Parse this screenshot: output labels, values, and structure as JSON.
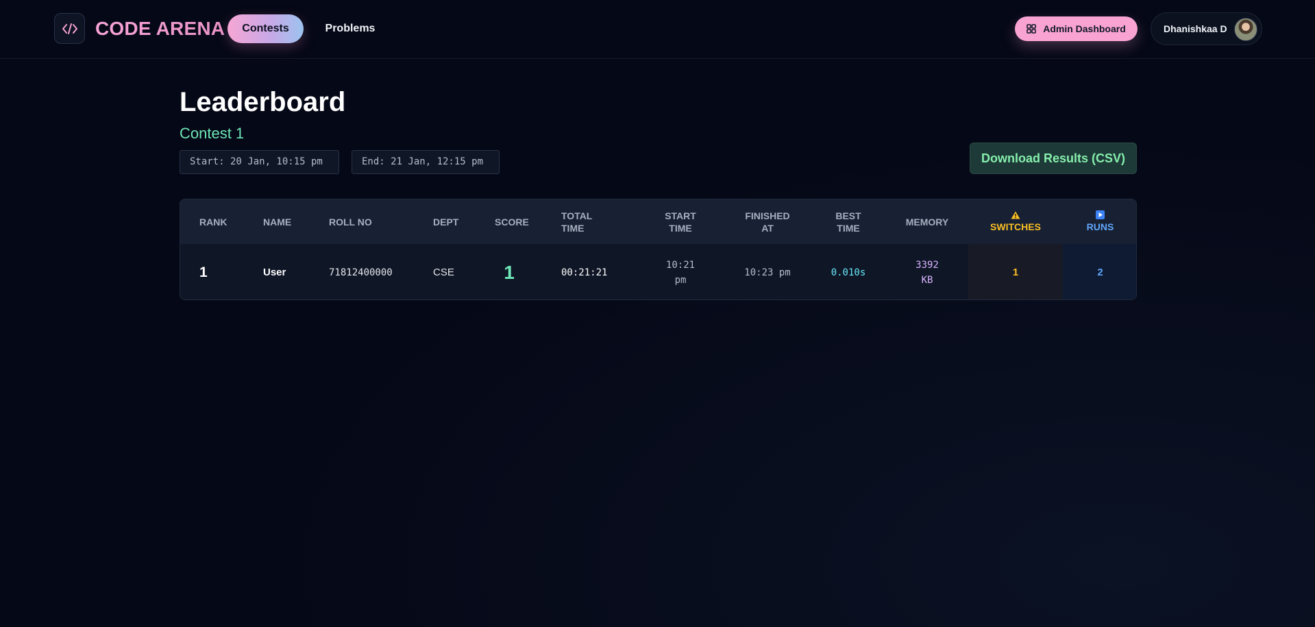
{
  "header": {
    "brand": "CODE ARENA",
    "nav": {
      "contests": "Contests",
      "problems": "Problems"
    },
    "admin_button": "Admin Dashboard",
    "user_name": "Dhanishkaa D"
  },
  "page": {
    "title": "Leaderboard",
    "contest_name": "Contest 1",
    "start": "Start: 20 Jan, 10:15 pm",
    "end": "End: 21 Jan, 12:15 pm",
    "download_button": "Download Results (CSV)"
  },
  "table": {
    "headers": {
      "rank": "RANK",
      "name": "NAME",
      "roll": "ROLL NO",
      "dept": "DEPT",
      "score": "SCORE",
      "total_time_1": "TOTAL",
      "total_time_2": "TIME",
      "start_time_1": "START",
      "start_time_2": "TIME",
      "finished_1": "FINISHED",
      "finished_2": "AT",
      "best_1": "BEST",
      "best_2": "TIME",
      "memory": "MEMORY",
      "switches": "SWITCHES",
      "runs": "RUNS"
    },
    "rows": [
      {
        "rank": "1",
        "name": "User",
        "roll": "71812400000",
        "dept": "CSE",
        "score": "1",
        "total_time": "00:21:21",
        "start_time_1": "10:21",
        "start_time_2": "pm",
        "finished_at": "10:23 pm",
        "best_time": "0.010s",
        "memory_1": "3392",
        "memory_2": "KB",
        "switches": "1",
        "runs": "2"
      }
    ]
  },
  "colors": {
    "accent_pink": "#f9a3d3",
    "accent_green": "#6ee7b7",
    "switch_amber": "#fbbf24",
    "runs_blue": "#60a5fa",
    "best_time_cyan": "#67e8f9",
    "memory_violet": "#d8b4fe"
  },
  "icons": {
    "logo": "code-brackets-icon",
    "admin": "grid-icon",
    "switches": "warning-icon",
    "runs": "play-icon"
  }
}
